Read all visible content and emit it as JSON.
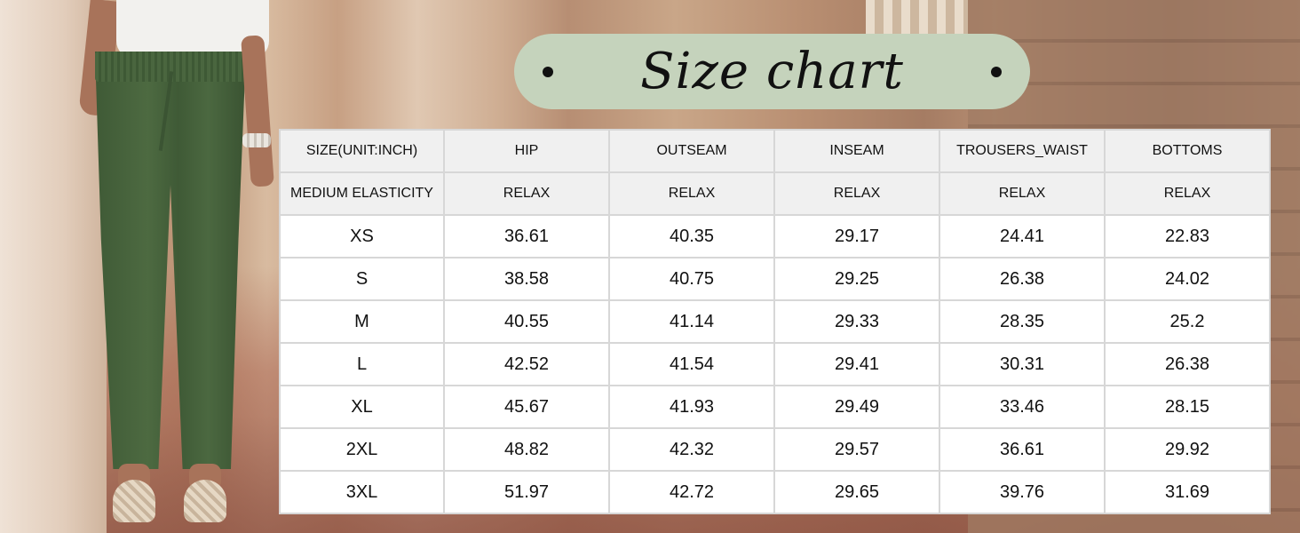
{
  "title": "Size chart",
  "colors": {
    "title_pill": "#c5d3bc",
    "header_bg": "#f0f0f0",
    "table_border": "#d7d7d7",
    "pants": "#4d6a41"
  },
  "table": {
    "header": [
      "SIZE(UNIT:INCH)",
      "HIP",
      "OUTSEAM",
      "INSEAM",
      "TROUSERS_WAIST",
      "BOTTOMS"
    ],
    "subheader": [
      "MEDIUM ELASTICITY",
      "RELAX",
      "RELAX",
      "RELAX",
      "RELAX",
      "RELAX"
    ],
    "rows": [
      [
        "XS",
        "36.61",
        "40.35",
        "29.17",
        "24.41",
        "22.83"
      ],
      [
        "S",
        "38.58",
        "40.75",
        "29.25",
        "26.38",
        "24.02"
      ],
      [
        "M",
        "40.55",
        "41.14",
        "29.33",
        "28.35",
        "25.2"
      ],
      [
        "L",
        "42.52",
        "41.54",
        "29.41",
        "30.31",
        "26.38"
      ],
      [
        "XL",
        "45.67",
        "41.93",
        "29.49",
        "33.46",
        "28.15"
      ],
      [
        "2XL",
        "48.82",
        "42.32",
        "29.57",
        "36.61",
        "29.92"
      ],
      [
        "3XL",
        "51.97",
        "42.72",
        "29.65",
        "39.76",
        "31.69"
      ]
    ]
  }
}
